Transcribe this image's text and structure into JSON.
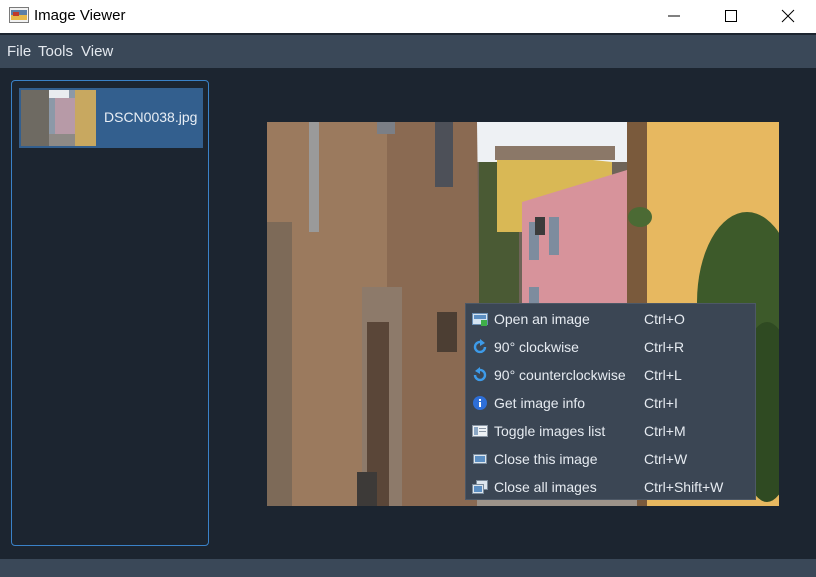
{
  "window": {
    "title": "Image Viewer",
    "controls": [
      "minimize",
      "maximize",
      "close"
    ]
  },
  "menubar": {
    "items": [
      {
        "label": "File"
      },
      {
        "label": "Tools"
      },
      {
        "label": "View"
      }
    ]
  },
  "sidebar": {
    "items": [
      {
        "label": "DSCN0038.jpg",
        "selected": true
      }
    ]
  },
  "context_menu": {
    "items": [
      {
        "label": "Open an image",
        "shortcut": "Ctrl+O",
        "icon": "open-image-icon"
      },
      {
        "label": "90° clockwise",
        "shortcut": "Ctrl+R",
        "icon": "rotate-clockwise-icon"
      },
      {
        "label": "90° counterclockwise",
        "shortcut": "Ctrl+L",
        "icon": "rotate-counterclockwise-icon"
      },
      {
        "label": "Get image info",
        "shortcut": "Ctrl+I",
        "icon": "info-icon"
      },
      {
        "label": "Toggle images list",
        "shortcut": "Ctrl+M",
        "icon": "list-icon"
      },
      {
        "label": "Close this image",
        "shortcut": "Ctrl+W",
        "icon": "close-image-icon"
      },
      {
        "label": "Close all images",
        "shortcut": "Ctrl+Shift+W",
        "icon": "close-all-images-icon"
      }
    ]
  },
  "colors": {
    "background": "#1c2530",
    "menubar": "#3a4858",
    "selection": "#335f8e",
    "accent_border": "#3a82c8",
    "context_menu": "#3b4654"
  }
}
